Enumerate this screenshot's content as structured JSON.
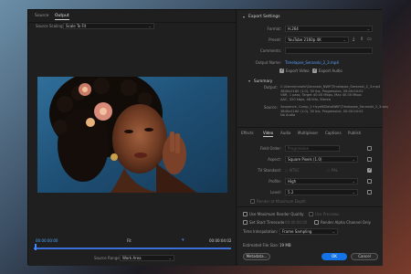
{
  "left": {
    "tabs": [
      {
        "label": "Source"
      },
      {
        "label": "Output"
      }
    ],
    "source_scaling_label": "Source Scaling:",
    "source_scaling_value": "Scale To Fit",
    "time_left": "00:00:00:00",
    "fit_label": "Fit",
    "time_right": "00:00:04:02",
    "source_range_label": "Source Range:",
    "source_range_value": "Work Area"
  },
  "right": {
    "export_settings_title": "Export Settings",
    "format_label": "Format:",
    "format_value": "H.264",
    "preset_label": "Preset:",
    "preset_value": "YouTube 2160p 4K",
    "comments_label": "Comments:",
    "output_name_label": "Output Name:",
    "output_name_value": "Timelapse_Seranski_2_3.mp4",
    "export_video_label": "Export Video",
    "export_audio_label": "Export Audio",
    "summary_title": "Summary",
    "output_summary_label": "Output:",
    "output_summary_lines": [
      "C:\\Users\\mrseki\\Seranski_NWF\\Timelapse_Seranski_2_3.mp4",
      "3840x2160 (1.0), 30 fps, Progressive, 00:00:04:02",
      "VBR, 1 pass, Target 40.00 Mbps, Max 40.00 Mbps",
      "AAC, 320 kbps, 48 kHz, Stereo"
    ],
    "source_summary_label": "Source:",
    "source_summary_lines": [
      "Sequence, Comp_1+IcyeKIDataNWF\\Timelapse_Seranski_2_3.seq",
      "3840x2160 (1.0), 30 fps, Progressive, 00:00:04:02",
      "No Audio"
    ],
    "subtabs": [
      {
        "label": "Effects"
      },
      {
        "label": "Video"
      },
      {
        "label": "Audio"
      },
      {
        "label": "Multiplexer"
      },
      {
        "label": "Captions"
      },
      {
        "label": "Publish"
      }
    ],
    "field_order_label": "Field Order:",
    "field_order_value": "Progressive",
    "aspect_label": "Aspect:",
    "aspect_value": "Square Pixels (1.0)",
    "tv_standard_label": "TV Standard:",
    "ntsc_label": "NTSC",
    "pal_label": "PAL",
    "profile_label": "Profile:",
    "profile_value": "High",
    "level_label": "Level:",
    "level_value": "5.2",
    "render_max_depth_label": "Render at Maximum Depth",
    "use_max_render_label": "Use Maximum Render Quality",
    "use_previews_label": "Use Previews",
    "set_start_timecode_label": "Set Start Timecode",
    "start_timecode_value": "00:00:00:00",
    "render_alpha_label": "Render Alpha Channel Only",
    "time_interp_label": "Time Interpolation:",
    "time_interp_value": "Frame Sampling",
    "est_file_size_label": "Estimated File Size:",
    "est_file_size_value": "19 MB",
    "metadata_button": "Metadata...",
    "ok_button": "OK",
    "cancel_button": "Cancel"
  },
  "colors": {
    "accent": "#1473e6",
    "link": "#5aa0ff",
    "panel": "#1f1f1f"
  }
}
